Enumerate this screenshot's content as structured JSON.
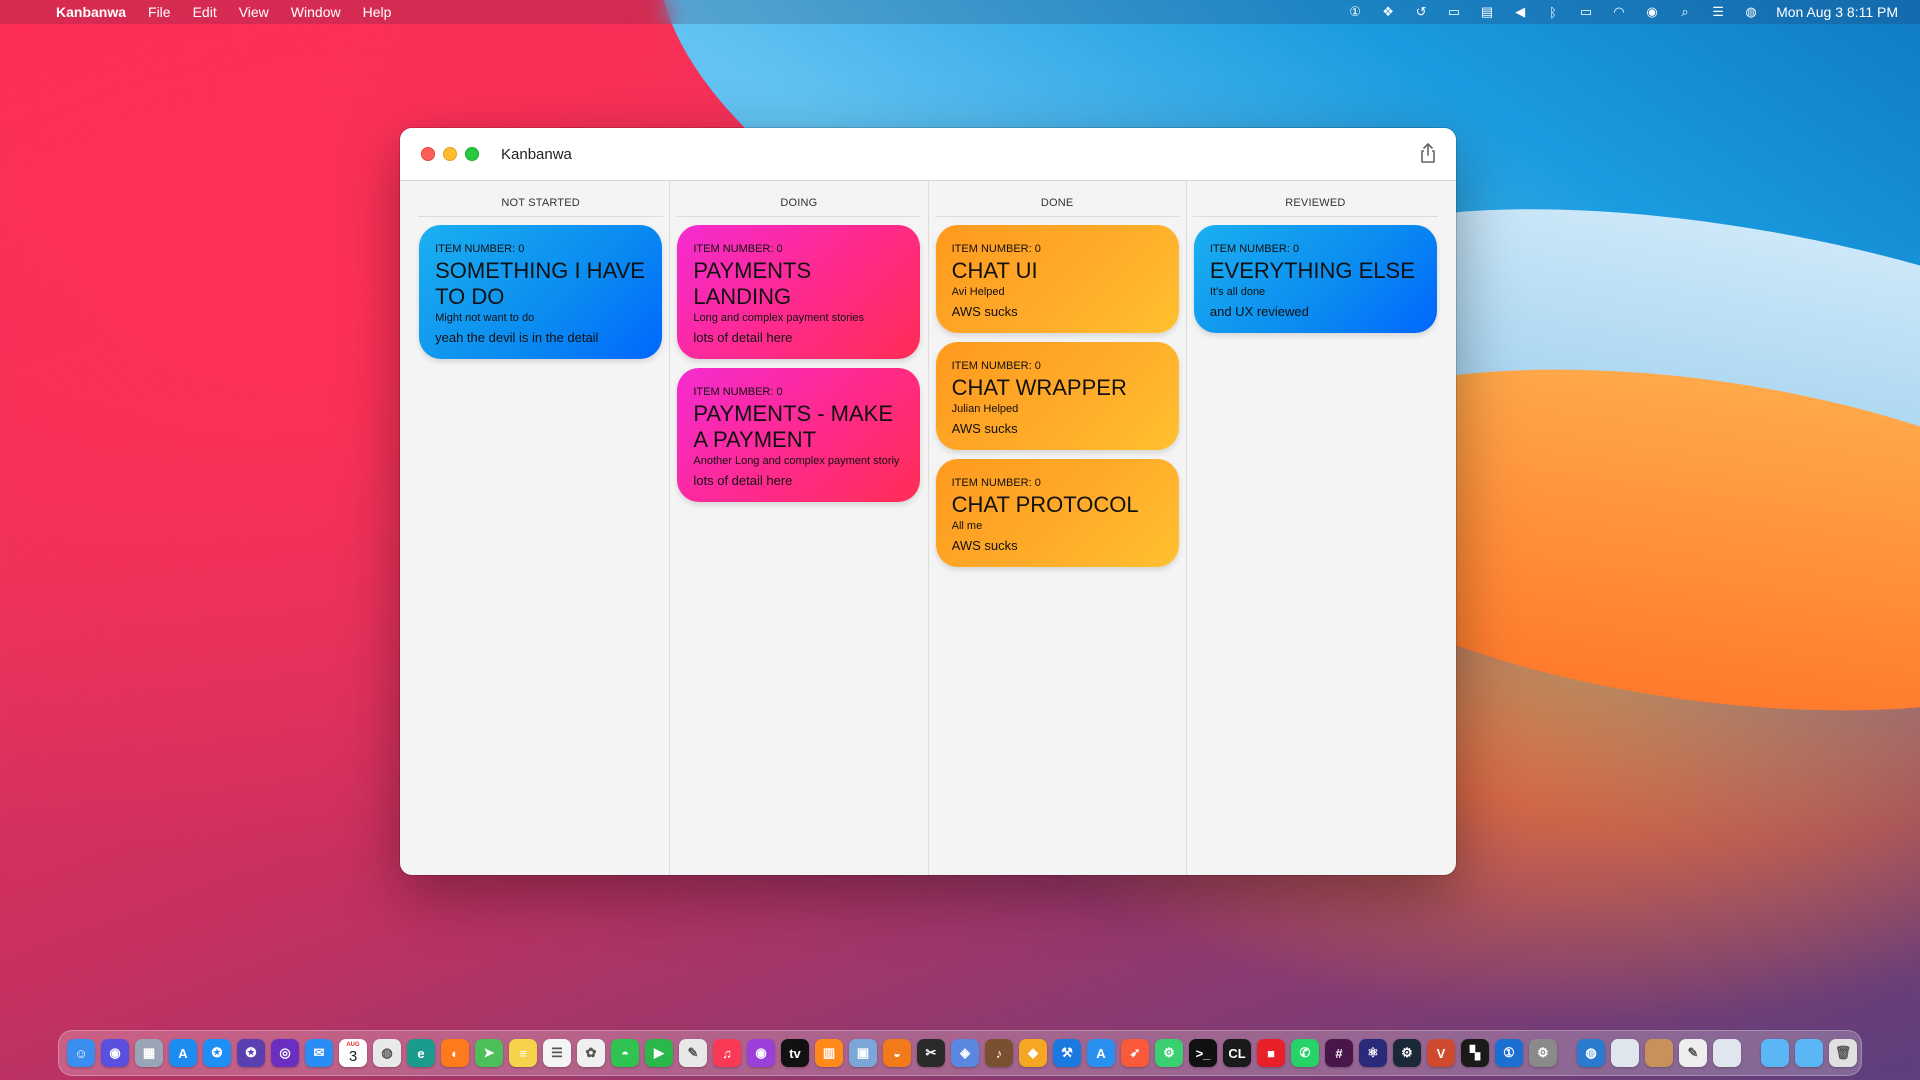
{
  "menubar": {
    "app_name": "Kanbanwa",
    "menus": [
      "File",
      "Edit",
      "View",
      "Window",
      "Help"
    ],
    "clock": "Mon Aug 3  8:11 PM"
  },
  "window": {
    "title": "Kanbanwa"
  },
  "board": {
    "columns": [
      {
        "name": "NOT STARTED",
        "cards": [
          {
            "item": "ITEM NUMBER: 0",
            "title": "SOMETHING I HAVE TO DO",
            "subtitle": "Might not want to do",
            "detail": "yeah the devil is in the detail",
            "color": "blue"
          }
        ]
      },
      {
        "name": "DOING",
        "cards": [
          {
            "item": "ITEM NUMBER: 0",
            "title": "PAYMENTS LANDING",
            "subtitle": "Long and complex payment stories",
            "detail": "lots of detail here",
            "color": "pink"
          },
          {
            "item": "ITEM NUMBER: 0",
            "title": "PAYMENTS - MAKE A PAYMENT",
            "subtitle": "Another Long and complex payment storiy",
            "detail": "lots of detail here",
            "color": "pink"
          }
        ]
      },
      {
        "name": "DONE",
        "cards": [
          {
            "item": "ITEM NUMBER: 0",
            "title": "CHAT UI",
            "subtitle": "Avi Helped",
            "detail": "AWS sucks",
            "color": "orange"
          },
          {
            "item": "ITEM NUMBER: 0",
            "title": "CHAT WRAPPER",
            "subtitle": "Julian Helped",
            "detail": "AWS sucks",
            "color": "orange"
          },
          {
            "item": "ITEM NUMBER: 0",
            "title": "CHAT PROTOCOL",
            "subtitle": "All me",
            "detail": "AWS sucks",
            "color": "orange"
          }
        ]
      },
      {
        "name": "REVIEWED",
        "cards": [
          {
            "item": "ITEM NUMBER: 0",
            "title": "EVERYTHING ELSE",
            "subtitle": "It's all done",
            "detail": "and UX reviewed",
            "color": "blue"
          }
        ]
      }
    ]
  },
  "colors": {
    "blue_card": "#0a8af0",
    "pink_card": "#ff2a8a",
    "orange_card": "#ffab2a"
  },
  "dock": {
    "calendar_month": "AUG",
    "calendar_day": "3",
    "icons": [
      {
        "name": "finder-icon",
        "bg": "#3a8ef0",
        "glyph": "☺"
      },
      {
        "name": "siri-icon",
        "bg": "#5b4fe0",
        "glyph": "◉"
      },
      {
        "name": "launchpad-icon",
        "bg": "#9aa6b8",
        "glyph": "▦"
      },
      {
        "name": "app-store-icon",
        "bg": "#1c8cf0",
        "glyph": "A"
      },
      {
        "name": "safari-icon",
        "bg": "#1e90f5",
        "glyph": "✪"
      },
      {
        "name": "safari-preview-icon",
        "bg": "#5a3fb0",
        "glyph": "✪"
      },
      {
        "name": "podcast-player-icon",
        "bg": "#6a2fc0",
        "glyph": "◎"
      },
      {
        "name": "mail-icon",
        "bg": "#2a8cf5",
        "glyph": "✉"
      },
      {
        "name": "calendar-icon",
        "bg": "#ffffff",
        "glyph": ""
      },
      {
        "name": "chrome-icon",
        "bg": "#e9e9e9",
        "glyph": "◍"
      },
      {
        "name": "edge-icon",
        "bg": "#1a9b8c",
        "glyph": "e"
      },
      {
        "name": "firefox-icon",
        "bg": "#ff7a1a",
        "glyph": "◐"
      },
      {
        "name": "maps-icon",
        "bg": "#4cbf5a",
        "glyph": "➤"
      },
      {
        "name": "notes-icon",
        "bg": "#f6d34a",
        "glyph": "≡"
      },
      {
        "name": "reminders-icon",
        "bg": "#f4f4f4",
        "glyph": "☰"
      },
      {
        "name": "photos-icon",
        "bg": "#f0f0f0",
        "glyph": "✿"
      },
      {
        "name": "messages-icon",
        "bg": "#2fc452",
        "glyph": "◓"
      },
      {
        "name": "facetime-icon",
        "bg": "#2ab84a",
        "glyph": "▶"
      },
      {
        "name": "textedit-icon",
        "bg": "#e8e8e8",
        "glyph": "✎"
      },
      {
        "name": "music-icon",
        "bg": "#fa3a55",
        "glyph": "♫"
      },
      {
        "name": "podcasts-icon",
        "bg": "#9a40d8",
        "glyph": "◉"
      },
      {
        "name": "apple-tv-icon",
        "bg": "#111111",
        "glyph": "tv"
      },
      {
        "name": "books-icon",
        "bg": "#ff8a1a",
        "glyph": "▥"
      },
      {
        "name": "preview-icon",
        "bg": "#7aa6d8",
        "glyph": "▣"
      },
      {
        "name": "blender-icon",
        "bg": "#f27a1a",
        "glyph": "◒"
      },
      {
        "name": "final-cut-icon",
        "bg": "#2a2a2a",
        "glyph": "✂"
      },
      {
        "name": "pixelmator-icon",
        "bg": "#5a88e0",
        "glyph": "◈"
      },
      {
        "name": "instruments-icon",
        "bg": "#7a5030",
        "glyph": "♪"
      },
      {
        "name": "sketch-icon",
        "bg": "#f5a623",
        "glyph": "◆"
      },
      {
        "name": "xcode-icon",
        "bg": "#1a7ae0",
        "glyph": "⚒"
      },
      {
        "name": "app-store-connect-icon",
        "bg": "#2a90f0",
        "glyph": "A"
      },
      {
        "name": "swift-playgrounds-icon",
        "bg": "#fa5a3a",
        "glyph": "➶"
      },
      {
        "name": "android-studio-icon",
        "bg": "#3ad070",
        "glyph": "⚙"
      },
      {
        "name": "terminal-icon",
        "bg": "#111111",
        "glyph": ">_"
      },
      {
        "name": "clion-icon",
        "bg": "#1a1a1a",
        "glyph": "CL"
      },
      {
        "name": "jetbrains-box-icon",
        "bg": "#e8202a",
        "glyph": "■"
      },
      {
        "name": "whatsapp-icon",
        "bg": "#25d366",
        "glyph": "✆"
      },
      {
        "name": "slack-icon",
        "bg": "#4a154b",
        "glyph": "#"
      },
      {
        "name": "visual-studio-icon",
        "bg": "#2a2a7a",
        "glyph": "⚛"
      },
      {
        "name": "steam-icon",
        "bg": "#1b2838",
        "glyph": "⚙"
      },
      {
        "name": "vim-icon",
        "bg": "#d04a30",
        "glyph": "V"
      },
      {
        "name": "activity-monitor-icon",
        "bg": "#1a1a1a",
        "glyph": "▚"
      },
      {
        "name": "1password-icon",
        "bg": "#1a6fd0",
        "glyph": "①"
      },
      {
        "name": "system-preferences-icon",
        "bg": "#8a8a8a",
        "glyph": "⚙"
      },
      {
        "name": "network-utility-icon",
        "bg": "#2a7ad0",
        "glyph": "◍"
      },
      {
        "name": "generic-app-icon-1",
        "bg": "#dfe6ee",
        "glyph": ""
      },
      {
        "name": "generic-app-icon-2",
        "bg": "#c8905a",
        "glyph": ""
      },
      {
        "name": "textedit-doc-icon",
        "bg": "#eeeeee",
        "glyph": "✎"
      },
      {
        "name": "generic-app-icon-3",
        "bg": "#dfe6ee",
        "glyph": ""
      },
      {
        "name": "folder-icon-1",
        "bg": "#5ab6f5",
        "glyph": ""
      },
      {
        "name": "folder-icon-2",
        "bg": "#5ab6f5",
        "glyph": ""
      },
      {
        "name": "trash-icon",
        "bg": "#e0e0e0",
        "glyph": "🗑"
      }
    ]
  }
}
